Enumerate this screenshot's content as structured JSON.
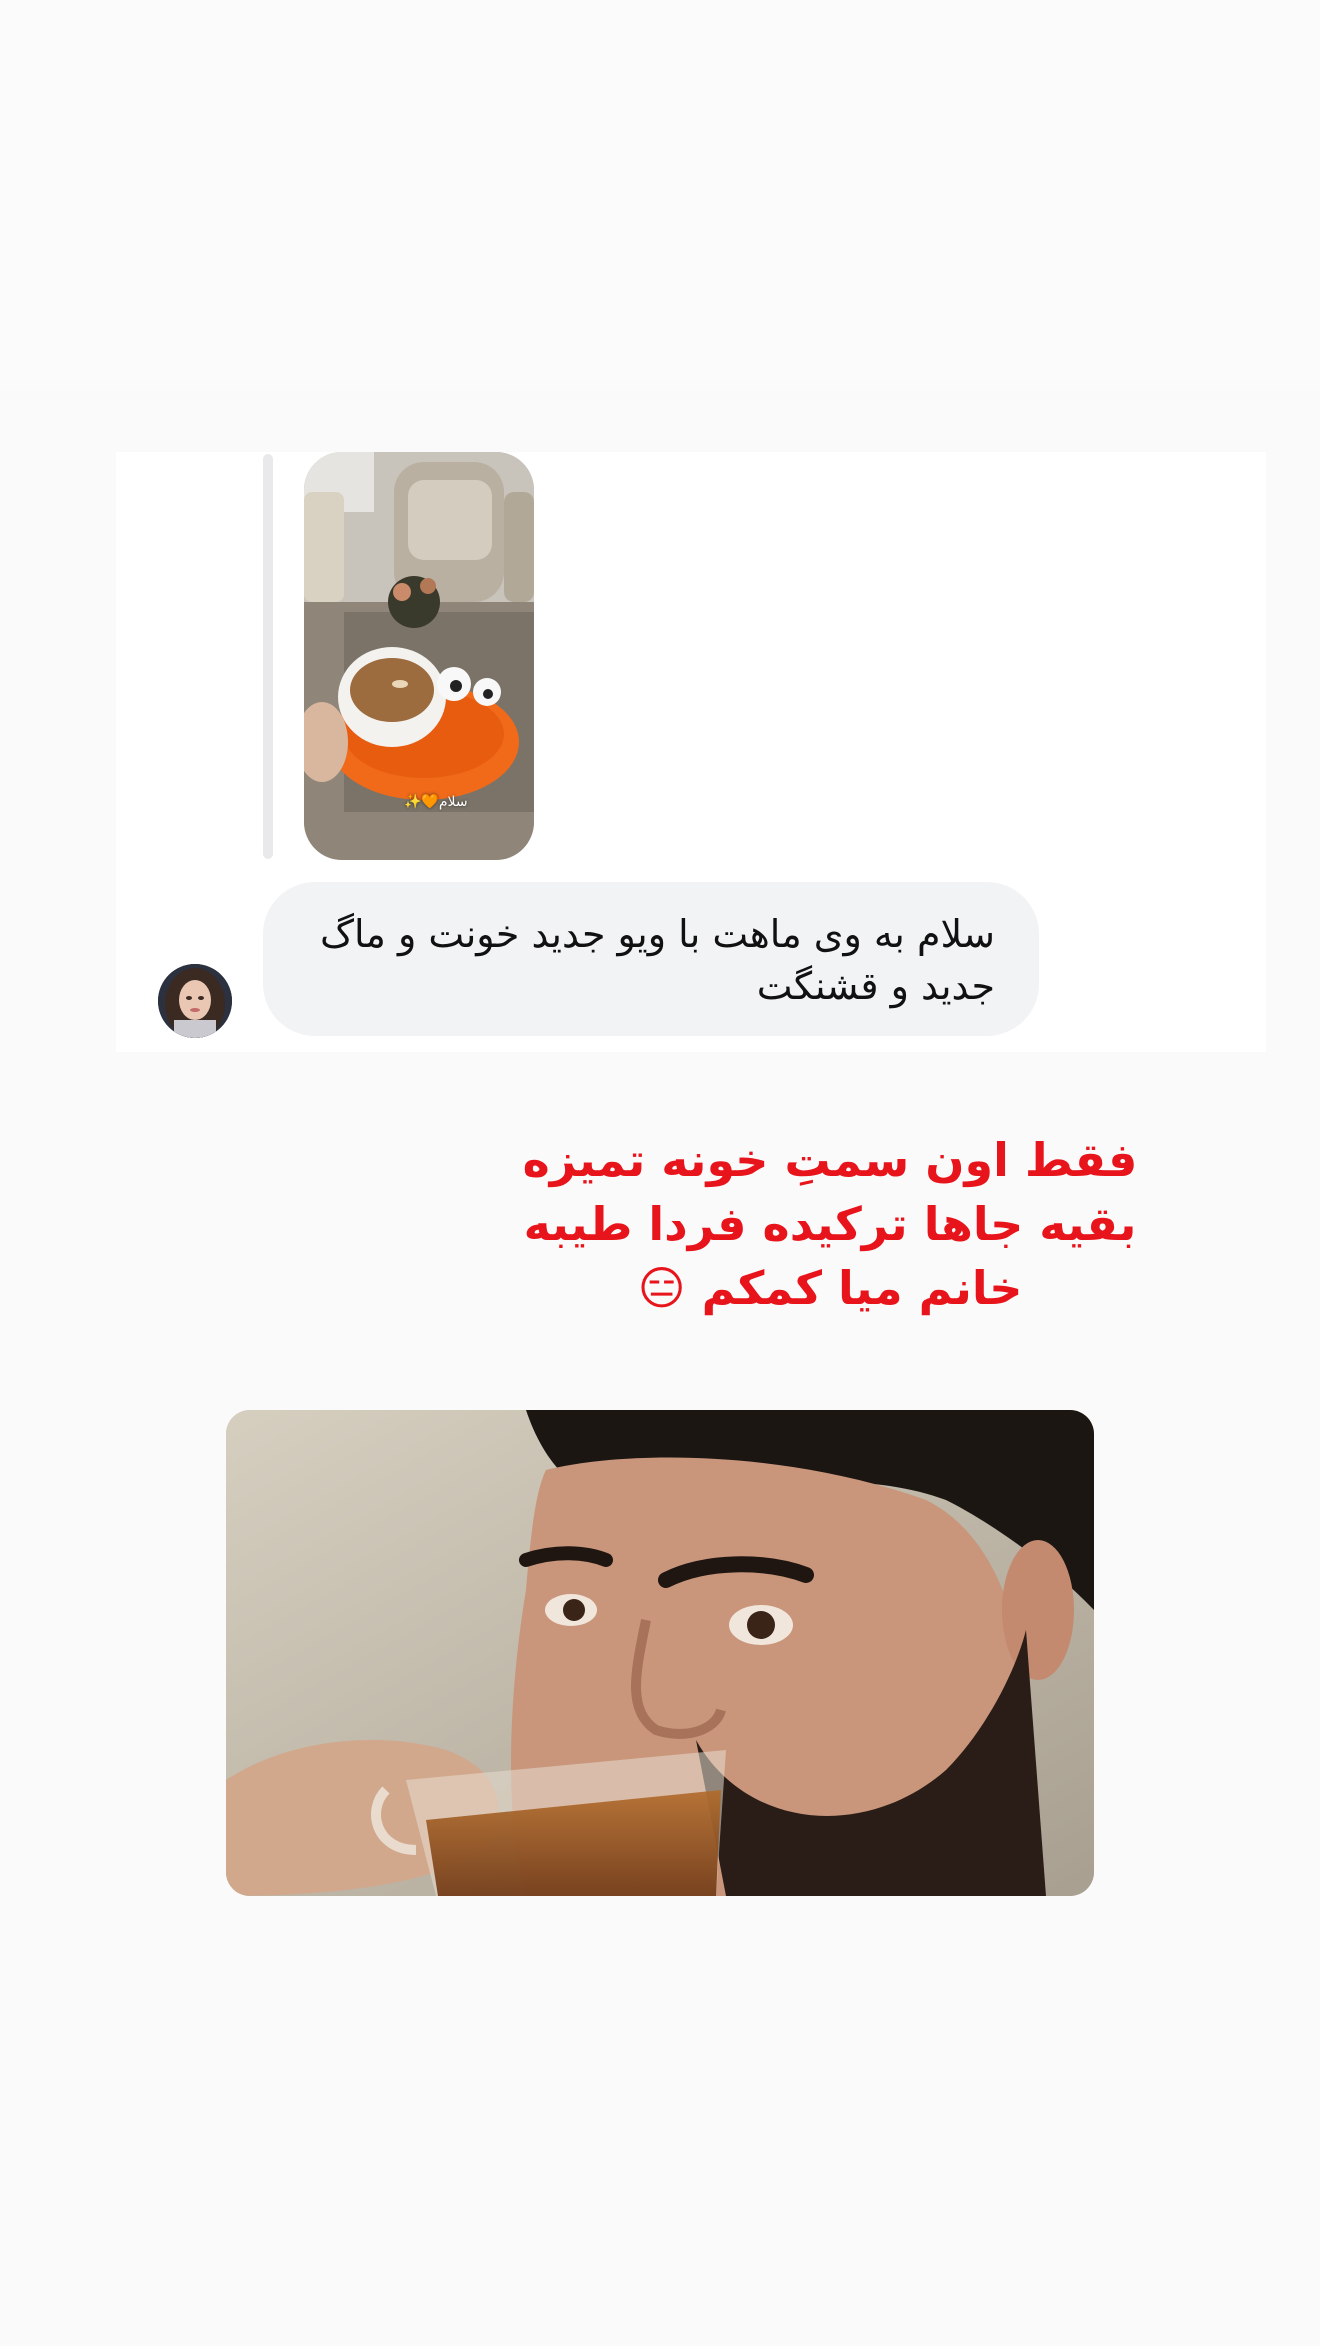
{
  "story_reply": {
    "story_caption": "سلام🧡✨",
    "message_text": "سلام به وی ماهت با ویو جدید خونت و ماگ جدید و قشنگت"
  },
  "overlay": {
    "text": "فقط اون سمتِ خونه تمیزه بقیه جاها ترکیده فردا طیبه خانم میا کمکم 😑",
    "color": "#e8141b"
  },
  "colors": {
    "page_background": "#fafafa",
    "bubble_background": "#f2f3f5",
    "card_background": "#ffffff"
  }
}
